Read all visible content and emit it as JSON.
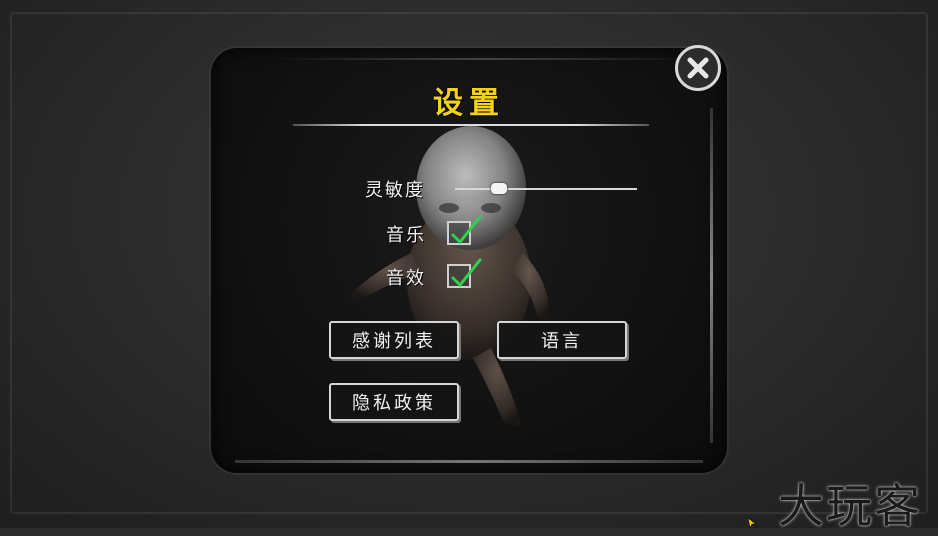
{
  "settings": {
    "title": "设置",
    "sensitivity_label": "灵敏度",
    "sensitivity_value": 0.24,
    "music_label": "音乐",
    "music_checked": true,
    "sfx_label": "音效",
    "sfx_checked": true
  },
  "buttons": {
    "credits": "感谢列表",
    "language": "语言",
    "privacy": "隐私政策"
  },
  "close_icon": "close-icon",
  "watermark": "大玩客",
  "colors": {
    "title": "#f3d21a",
    "check": "#2fd24a"
  }
}
